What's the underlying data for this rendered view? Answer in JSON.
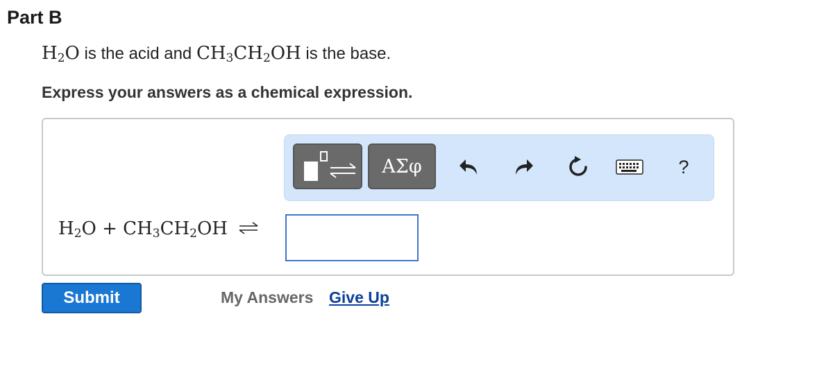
{
  "part": {
    "title": "Part B"
  },
  "statement": {
    "acid_formula": [
      "H",
      "2",
      "O"
    ],
    "middle_text": " is the acid and ",
    "base_formula": [
      "CH",
      "3",
      "CH",
      "2",
      "OH"
    ],
    "end_text": " is the base."
  },
  "instruction": "Express your answers as a chemical expression.",
  "toolbar": {
    "template_icon": "templates-reaction-arrow-icon",
    "symbols_label": "ΑΣφ",
    "undo_icon": "undo-icon",
    "redo_icon": "redo-icon",
    "reset_icon": "reset-icon",
    "keyboard_icon": "keyboard-icon",
    "help_label": "?"
  },
  "equation": {
    "reactant1": [
      "H",
      "2",
      "O"
    ],
    "plus": " + ",
    "reactant2": [
      "CH",
      "3",
      "CH",
      "2",
      "OH"
    ]
  },
  "answer": {
    "value": ""
  },
  "actions": {
    "submit_label": "Submit",
    "my_answers_label": "My Answers",
    "give_up_label": "Give Up"
  },
  "colors": {
    "toolbar_bg": "#d3e6fb",
    "submit_bg": "#1a77d2",
    "link_color": "#0b3f9c",
    "input_border": "#3d76c9"
  }
}
